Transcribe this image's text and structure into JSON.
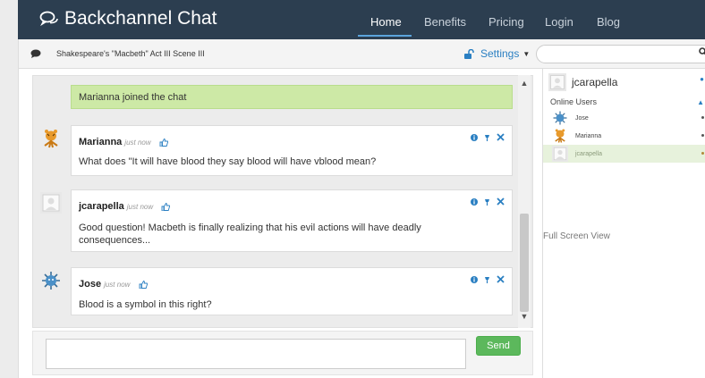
{
  "navbar": {
    "brand": "Backchannel Chat",
    "links": [
      {
        "label": "Home",
        "active": true
      },
      {
        "label": "Benefits",
        "active": false
      },
      {
        "label": "Pricing",
        "active": false
      },
      {
        "label": "Login",
        "active": false
      },
      {
        "label": "Blog",
        "active": false
      }
    ]
  },
  "room": {
    "title": "Shakespeare's \"Macbeth\" Act III Scene III",
    "settings_label": "Settings",
    "search_placeholder": ""
  },
  "chat": {
    "join_message": "Marianna joined the chat",
    "messages": [
      {
        "author": "Marianna",
        "time": "just now",
        "avatar": "tiger-avatar-icon",
        "text": "What does \"It will have blood they say blood will have vblood mean?"
      },
      {
        "author": "jcarapella",
        "time": "just now",
        "avatar": "default-avatar-icon",
        "text": "Good question! Macbeth is finally realizing that his evil actions will have deadly consequences..."
      },
      {
        "author": "Jose",
        "time": "just now",
        "avatar": "germ-avatar-icon",
        "text": "Blood is a symbol in this right?"
      }
    ],
    "composer_value": "",
    "send_label": "Send"
  },
  "sidebar": {
    "current_user": "jcarapella",
    "online_title": "Online Users",
    "online_users": [
      {
        "name": "Jose",
        "avatar": "germ-avatar-icon",
        "me": false
      },
      {
        "name": "Marianna",
        "avatar": "tiger-avatar-icon",
        "me": false
      },
      {
        "name": "jcarapella",
        "avatar": "default-avatar-icon",
        "me": true
      }
    ],
    "fullscreen_label": "Full Screen View"
  },
  "colors": {
    "navbar": "#2c3e50",
    "accent": "#2a7fc2",
    "join_bg": "#cde9a6",
    "send": "#5cb85c"
  }
}
